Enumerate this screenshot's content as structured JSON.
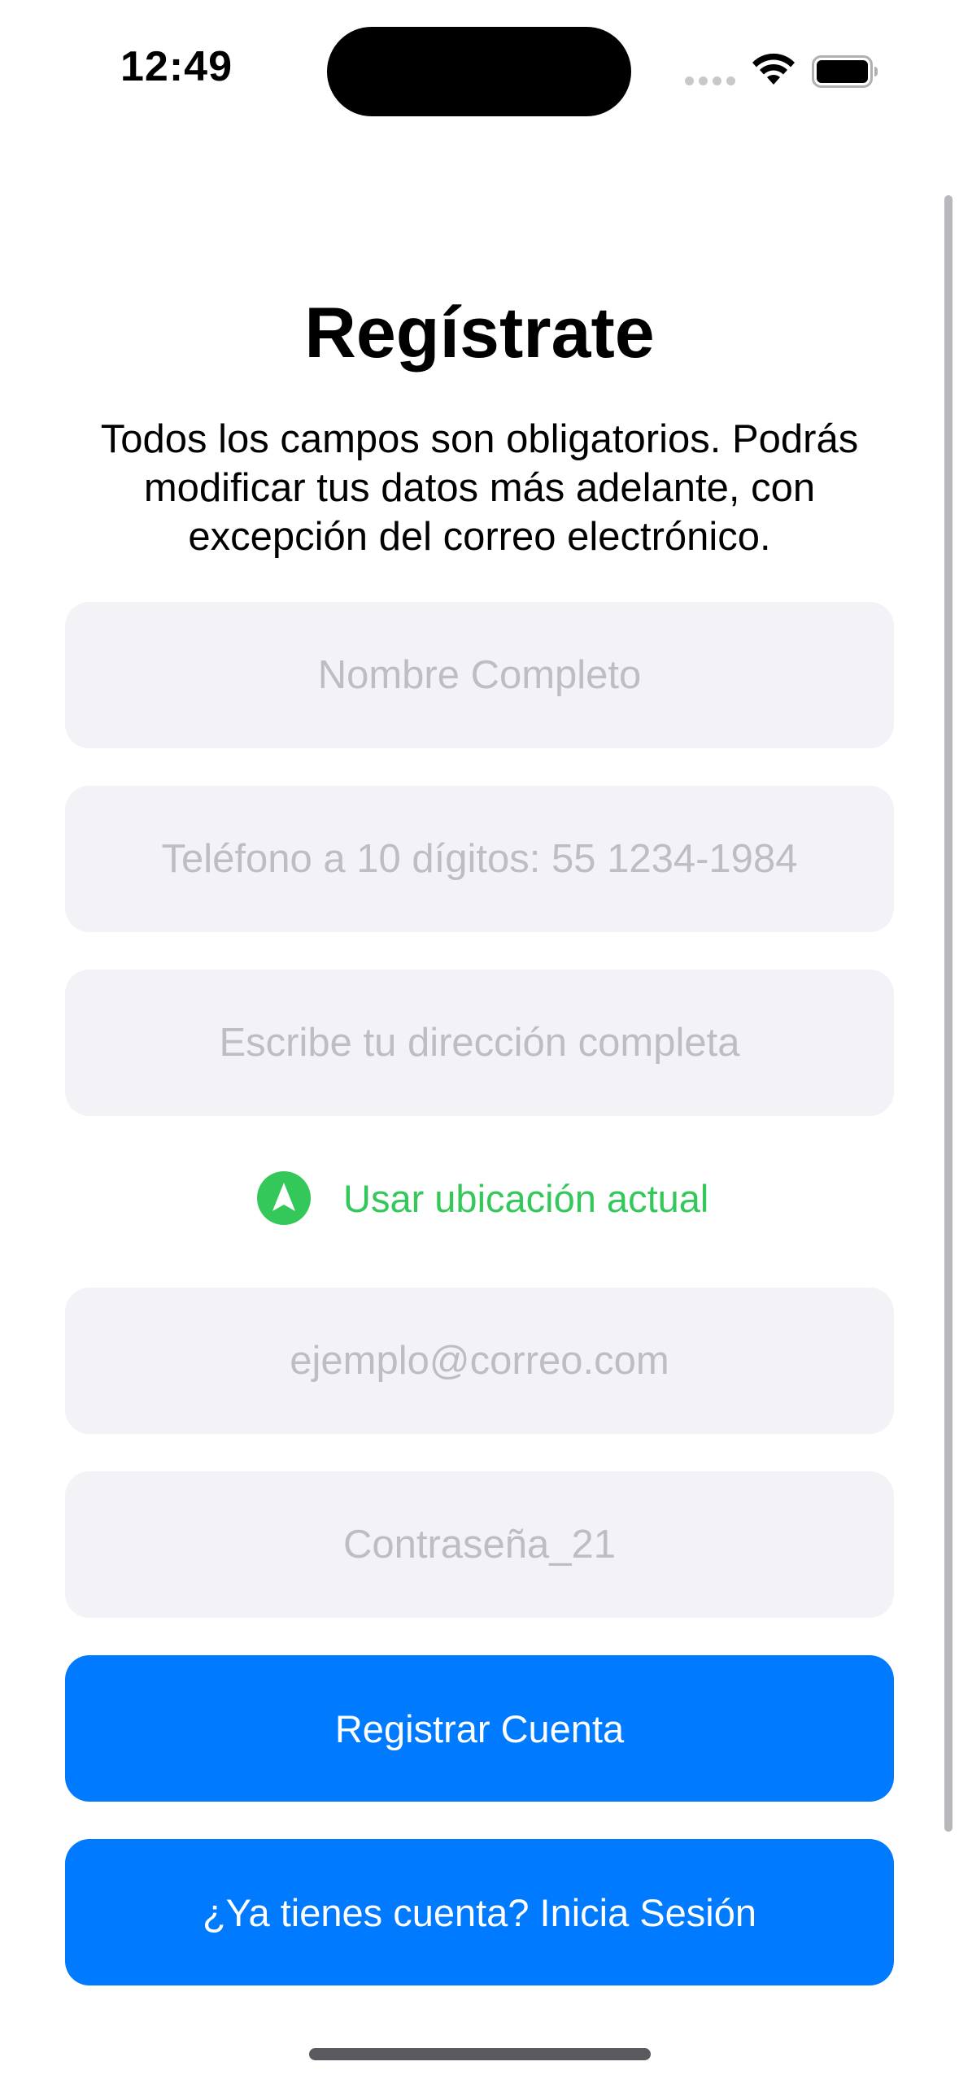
{
  "status_bar": {
    "time": "12:49"
  },
  "header": {
    "title": "Regístrate",
    "subtitle": "Todos los campos son obligatorios. Podrás modificar tus datos más adelante, con excepción del correo electrónico."
  },
  "form": {
    "full_name": {
      "placeholder": "Nombre Completo",
      "value": ""
    },
    "phone": {
      "placeholder": "Teléfono a 10 dígitos: 55 1234-1984",
      "value": ""
    },
    "address": {
      "placeholder": "Escribe tu dirección completa",
      "value": ""
    },
    "use_location_label": "Usar ubicación actual",
    "email": {
      "placeholder": "ejemplo@correo.com",
      "value": ""
    },
    "password": {
      "placeholder": "Contraseña_21",
      "value": ""
    }
  },
  "actions": {
    "register_label": "Registrar Cuenta",
    "login_label": "¿Ya tienes cuenta? Inicia Sesión"
  },
  "colors": {
    "primary": "#007aff",
    "location_green": "#34c759",
    "field_background": "#f2f2f7",
    "placeholder": "#bdbdc2"
  },
  "icons": {
    "location": "location-arrow-icon",
    "wifi": "wifi-icon",
    "battery": "battery-icon",
    "signal": "signal-dots-icon"
  }
}
